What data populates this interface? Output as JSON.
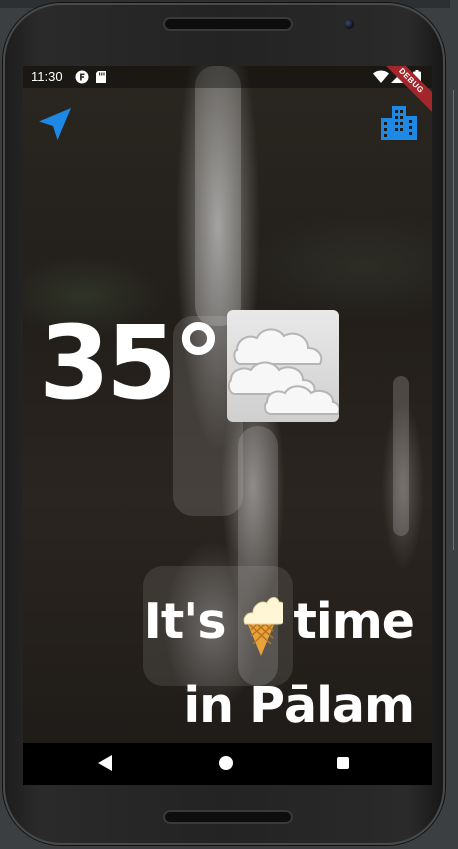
{
  "status_bar": {
    "time": "11:30",
    "icons": [
      "notification-f-icon",
      "sd-card-icon",
      "wifi-icon",
      "signal-icon",
      "battery-icon"
    ],
    "debug_label": "DEBUG"
  },
  "toolbar": {
    "location_button_icon": "navigation-arrow-icon",
    "city_button_icon": "city-buildings-icon",
    "accent_color": "#1e88e5"
  },
  "weather": {
    "temperature": "35°",
    "condition_icon": "fog-cloud-icon"
  },
  "message": {
    "line1_prefix": "It's",
    "line1_suffix": "time",
    "emoji": "ice-cream-icon",
    "line2": "in Pālam"
  },
  "nav_bar": {
    "buttons": [
      "back-icon",
      "home-icon",
      "recents-icon"
    ]
  }
}
